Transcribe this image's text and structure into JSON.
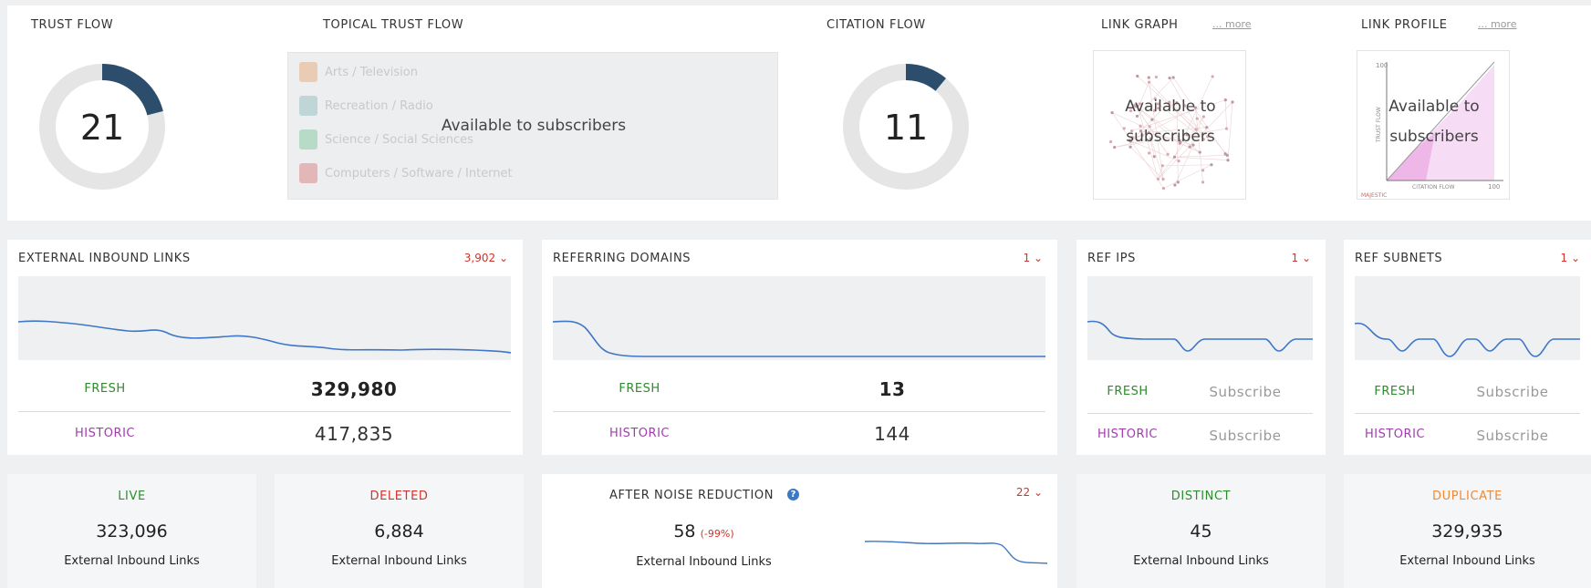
{
  "top": {
    "trust_flow": {
      "title": "TRUST FLOW",
      "value": "21",
      "fraction": 0.21
    },
    "topical": {
      "title": "TOPICAL TRUST FLOW",
      "overlay": "Available to subscribers",
      "items": [
        {
          "label": "Arts / Television",
          "color": "#e88a44"
        },
        {
          "label": "Recreation / Radio",
          "color": "#6fa6a6"
        },
        {
          "label": "Science / Social Sciences",
          "color": "#55b877"
        },
        {
          "label": "Computers / Software / Internet",
          "color": "#d55050"
        }
      ]
    },
    "citation_flow": {
      "title": "CITATION FLOW",
      "value": "11",
      "fraction": 0.11
    },
    "link_graph": {
      "title": "LINK GRAPH",
      "more": "... more",
      "overlay_line1": "Available to",
      "overlay_line2": "subscribers"
    },
    "link_profile": {
      "title": "LINK PROFILE",
      "more": "... more",
      "overlay_line1": "Available to",
      "overlay_line2": "subscribers",
      "axis_y_label": "TRUST FLOW",
      "axis_x_label": "CITATION FLOW",
      "tick_100_y": "100",
      "tick_100_x": "100",
      "brand": "MAJESTIC"
    }
  },
  "mid": {
    "external": {
      "title": "EXTERNAL INBOUND LINKS",
      "dropdown": "3,902",
      "fresh_label": "FRESH",
      "fresh_value": "329,980",
      "historic_label": "HISTORIC",
      "historic_value": "417,835"
    },
    "referring": {
      "title": "REFERRING DOMAINS",
      "dropdown": "1",
      "fresh_label": "FRESH",
      "fresh_value": "13",
      "historic_label": "HISTORIC",
      "historic_value": "144"
    },
    "ref_ips": {
      "title": "REF IPS",
      "dropdown": "1",
      "fresh_label": "FRESH",
      "fresh_value": "Subscribe",
      "historic_label": "HISTORIC",
      "historic_value": "Subscribe"
    },
    "ref_subnets": {
      "title": "REF SUBNETS",
      "dropdown": "1",
      "fresh_label": "FRESH",
      "fresh_value": "Subscribe",
      "historic_label": "HISTORIC",
      "historic_value": "Subscribe"
    }
  },
  "bottom": {
    "live": {
      "label": "LIVE",
      "value": "323,096",
      "sub": "External Inbound Links"
    },
    "deleted": {
      "label": "DELETED",
      "value": "6,884",
      "sub": "External Inbound Links"
    },
    "noise": {
      "label": "AFTER NOISE REDUCTION",
      "help": "?",
      "dropdown": "22",
      "value": "58",
      "pct": "(-99%)",
      "sub": "External Inbound Links"
    },
    "distinct": {
      "label": "DISTINCT",
      "value": "45",
      "sub": "External Inbound Links"
    },
    "duplicate": {
      "label": "DUPLICATE",
      "value": "329,935",
      "sub": "External Inbound Links"
    }
  },
  "colors": {
    "donut_fill": "#2c4e6c",
    "donut_track": "#e5e5e5",
    "line": "#3f76c6",
    "accent_red": "#d0342c"
  },
  "icons": {
    "dropdown": "chevron-down-icon",
    "help": "help-icon"
  }
}
